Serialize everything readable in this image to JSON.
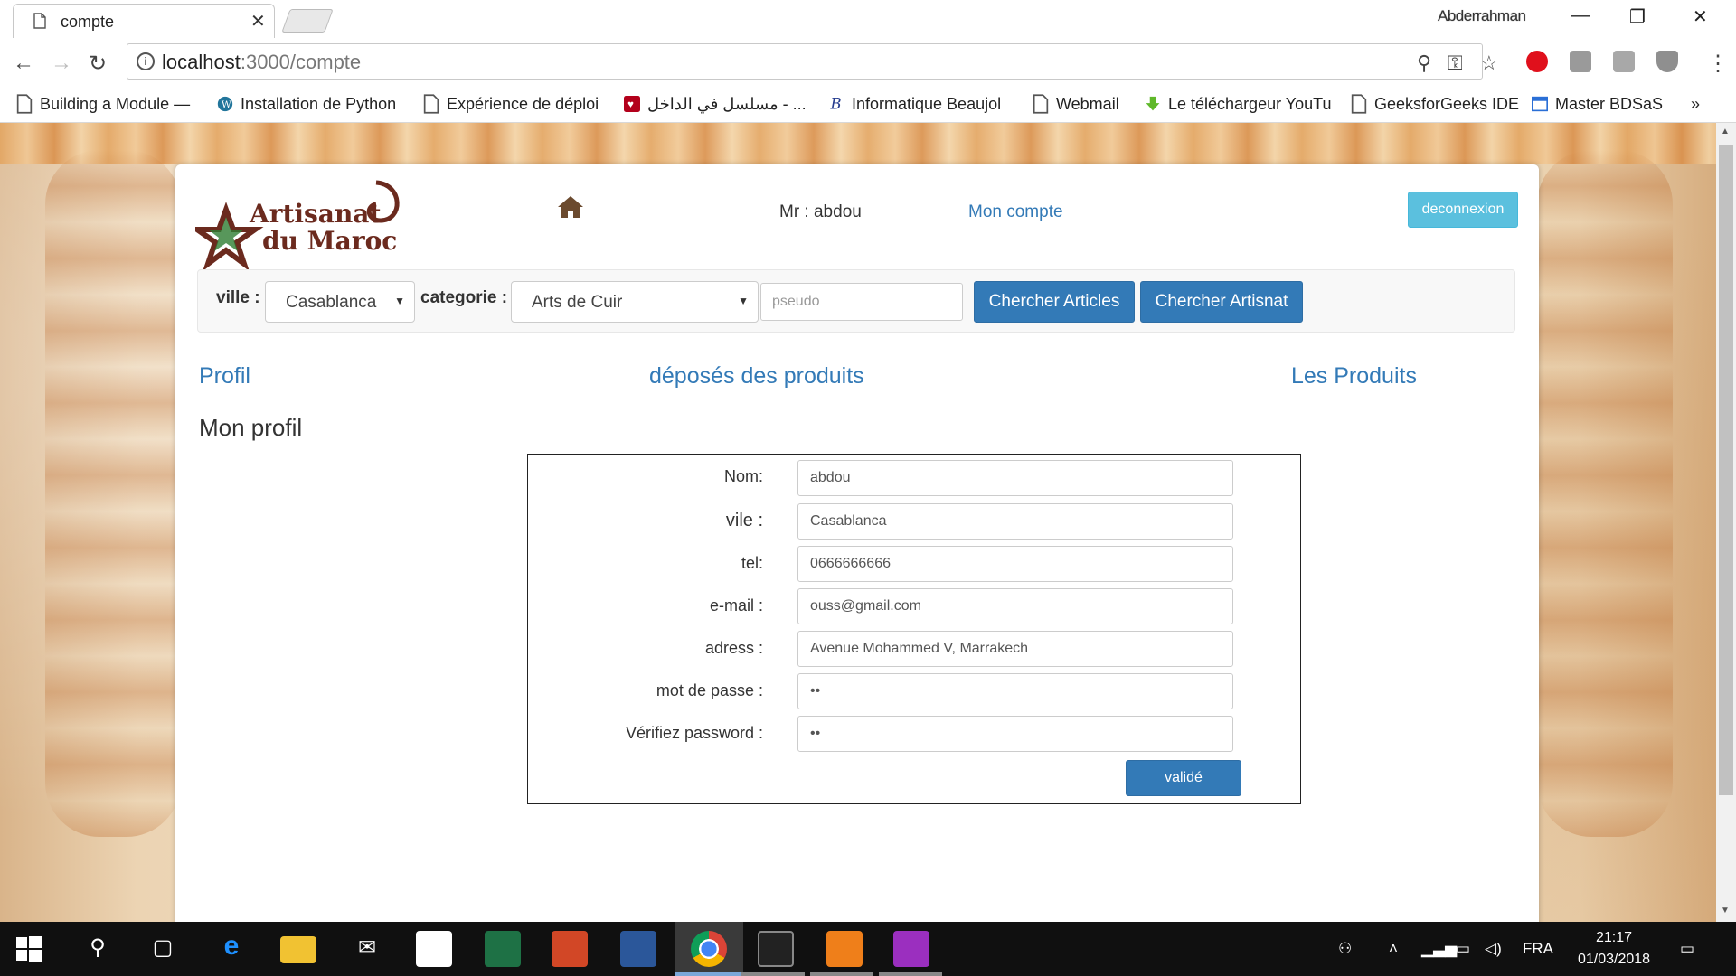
{
  "browser": {
    "tab_title": "compte",
    "user_name": "Abderrahman",
    "url_host": "localhost",
    "url_path": ":3000/compte",
    "bookmarks": [
      {
        "label": "Building a Module —",
        "icon": "page-icon"
      },
      {
        "label": "Installation de Python",
        "icon": "wordpress-icon"
      },
      {
        "label": "Expérience de déploi",
        "icon": "page-icon"
      },
      {
        "label": "مسلسل في الداخل - ...",
        "icon": "heart-icon"
      },
      {
        "label": "Informatique Beaujol",
        "icon": "b-icon"
      },
      {
        "label": "Webmail",
        "icon": "page-icon"
      },
      {
        "label": "Le téléchargeur YouTu",
        "icon": "download-icon"
      },
      {
        "label": "GeeksforGeeks IDE",
        "icon": "page-icon"
      },
      {
        "label": "Master BDSaS",
        "icon": "window-icon"
      }
    ],
    "more": "»"
  },
  "site": {
    "logo_line1": "Artisanat",
    "logo_line2": "du Maroc",
    "greeting": "Mr : abdou",
    "account_link": "Mon compte",
    "logout": "deconnexion",
    "colors": {
      "primary": "#337ab7",
      "info": "#5bc0de",
      "logo": "#6b2a1e"
    }
  },
  "search": {
    "ville_label": "ville :",
    "ville_value": "Casablanca",
    "categorie_label": "categorie :",
    "categorie_value": "Arts de Cuir",
    "pseudo_placeholder": "pseudo",
    "btn_articles": "Chercher Articles",
    "btn_artisans": "Chercher Artisnat"
  },
  "nav": {
    "profil": "Profil",
    "deposes": "déposés des produits",
    "produits": "Les Produits"
  },
  "profile": {
    "title": "Mon profil",
    "fields": [
      {
        "label": "Nom:",
        "value": "abdou"
      },
      {
        "label": "vile :",
        "value": "Casablanca"
      },
      {
        "label": "tel:",
        "value": "0666666666"
      },
      {
        "label": "e-mail :",
        "value": "ouss@gmail.com"
      },
      {
        "label": "adress :",
        "value": "Avenue Mohammed V, Marrakech"
      },
      {
        "label": "mot de passe :",
        "value": "••"
      },
      {
        "label": "Vérifiez password :",
        "value": "••"
      }
    ],
    "submit": "validé"
  },
  "taskbar": {
    "language": "FRA",
    "time": "21:17",
    "date": "01/03/2018"
  }
}
